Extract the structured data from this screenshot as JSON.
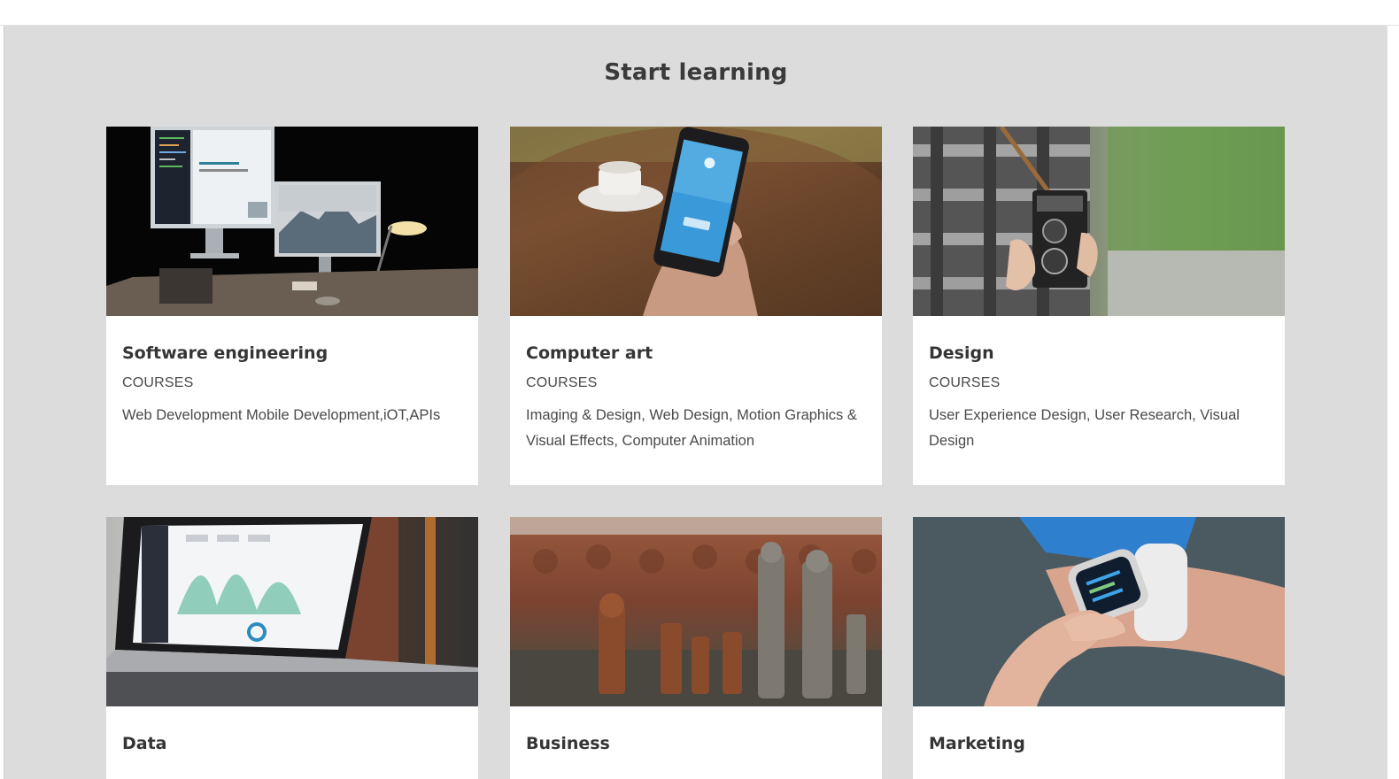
{
  "section": {
    "title": "Start learning"
  },
  "cards": [
    {
      "title": "Software engineering",
      "label": "COURSES",
      "description": "Web Development Mobile Development,iOT,APIs",
      "image_icon": "desk-computers-image"
    },
    {
      "title": "Computer art",
      "label": "COURSES",
      "description": "Imaging & Design, Web Design, Motion Graphics & Visual Effects, Computer Animation",
      "image_icon": "phone-in-hand-image"
    },
    {
      "title": "Design",
      "label": "COURSES",
      "description": "User Experience Design, User Research, Visual Design",
      "image_icon": "camera-photographer-image"
    },
    {
      "title": "Data",
      "image_icon": "laptop-dashboard-image"
    },
    {
      "title": "Business",
      "image_icon": "chess-pieces-image"
    },
    {
      "title": "Marketing",
      "image_icon": "smartwatch-wrist-image"
    }
  ],
  "colors": {
    "section_background": "#dcdcdc",
    "card_background": "#ffffff",
    "text": "#3a3a3a"
  }
}
